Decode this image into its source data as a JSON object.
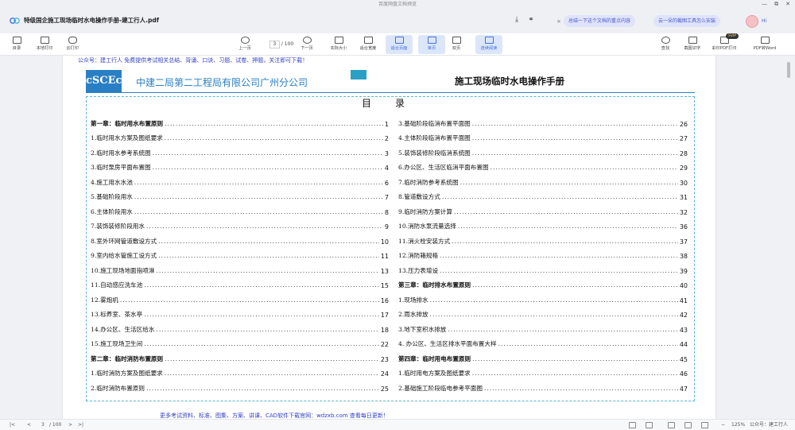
{
  "titlebar": {
    "title": "百度网盘文档预览",
    "controls": [
      "—",
      "⧉",
      "✕"
    ]
  },
  "header": {
    "document_title": "特级国企施工现场临时水电操作手册-建工行人.pdf",
    "ai_chips": [
      "总结一下这个文档的重点内容",
      "云一朵的截图工具怎么安装"
    ],
    "greeting": "Hi"
  },
  "toolbar": {
    "left": [
      {
        "label": "目录"
      },
      {
        "label": "本地打印"
      },
      {
        "label": "云打印"
      }
    ],
    "center": [
      {
        "label": "上一页"
      },
      {
        "label": "下一页"
      },
      {
        "label": "实际大小"
      },
      {
        "label": "适合宽度"
      },
      {
        "label": "适合页面",
        "active": true
      },
      {
        "label": "单页",
        "active": true
      },
      {
        "label": "双页"
      },
      {
        "label": "连续阅读",
        "active": true
      }
    ],
    "page_current": "3",
    "page_total": "/ 100",
    "right": [
      {
        "label": "查找"
      },
      {
        "label": "截图识字"
      },
      {
        "label": "彩印PDF打印"
      },
      {
        "label": "PDF转Word"
      }
    ],
    "vip_badge": "SVIP"
  },
  "document": {
    "promo_top": "公众号：建工行人 免费提供考试相关总结、背诵、口诀、习题、试卷、押题，关注即可下载！",
    "logo_text": "cSCEc",
    "company": "中建二局第二工程局有限公司广州分公司",
    "manual_title": "施工现场临时水电操作手册",
    "toc_heading": "目录",
    "promo_bottom": "更多考试资料、标准、图集、方案、讲课、CAD软件下载官网：wdzxb.com 查看每日更新！",
    "toc_left": [
      {
        "title": "第一章：临时用水布置原则",
        "page": "1",
        "chapter": true
      },
      {
        "title": "1.临时用水方案及图纸要求",
        "page": "2"
      },
      {
        "title": "2.临时用水参考系统图",
        "page": "3"
      },
      {
        "title": "3.临时泵房平面布置图",
        "page": "4"
      },
      {
        "title": "4.施工用水水池",
        "page": "6"
      },
      {
        "title": "5.基础阶段用水",
        "page": "7"
      },
      {
        "title": "6.主体阶段用水",
        "page": "8"
      },
      {
        "title": "7.装饰装修阶段用水",
        "page": "9"
      },
      {
        "title": "8.室外环网管道敷设方式",
        "page": "10"
      },
      {
        "title": "9.室内给水管施工设方式",
        "page": "11"
      },
      {
        "title": "10.施工现场地面指喷淋",
        "page": "13"
      },
      {
        "title": "11.自动感应洗车池",
        "page": "15"
      },
      {
        "title": "12.雾炮机",
        "page": "16"
      },
      {
        "title": "13.标养室、茶水亭",
        "page": "17"
      },
      {
        "title": "14.办公区、生活区给水",
        "page": "18"
      },
      {
        "title": "15.施工现场卫生间",
        "page": "22"
      },
      {
        "title": "第二章：临时消防布置原则",
        "page": "23",
        "chapter": true
      },
      {
        "title": "1.临时消防方案及图纸要求",
        "page": "24"
      },
      {
        "title": "2.临时消防布置原则",
        "page": "25"
      }
    ],
    "toc_right": [
      {
        "title": "3.基础阶段临消布置平面图",
        "page": "26"
      },
      {
        "title": "4.主体阶段临消布置平面图",
        "page": "27"
      },
      {
        "title": "5.装饰装修阶段临消系统图",
        "page": "28"
      },
      {
        "title": "6.办公区、生活区临消平面布置图",
        "page": "29"
      },
      {
        "title": "7.临时消防参考系统图",
        "page": "30"
      },
      {
        "title": "8.管道敷设方式",
        "page": "31"
      },
      {
        "title": "9.临时消防方案计算",
        "page": "32"
      },
      {
        "title": "10.消防水泵流量选择",
        "page": "36"
      },
      {
        "title": "11.消火栓安装方式",
        "page": "37"
      },
      {
        "title": "12.消防箱规格",
        "page": "38"
      },
      {
        "title": "13.压力表增设",
        "page": "39"
      },
      {
        "title": "第三章：临时排水布置原则",
        "page": "40",
        "chapter": true
      },
      {
        "title": "1.现场排水",
        "page": "41"
      },
      {
        "title": "2.雨水排放",
        "page": "42"
      },
      {
        "title": "3.地下室积水排放",
        "page": "43"
      },
      {
        "title": "4. 办公区、生活区排水平面布置大样",
        "page": "44"
      },
      {
        "title": "第四章：临时用电布置原则",
        "page": "45",
        "chapter": true
      },
      {
        "title": "1.临时用电方案及图纸要求",
        "page": "46"
      },
      {
        "title": "2.基础施工阶段临电参考平面图",
        "page": "47"
      }
    ]
  },
  "statusbar": {
    "page_current": "3",
    "page_total": "/ 100",
    "zoom": "125%",
    "watermark": "公众号：建工行人"
  }
}
